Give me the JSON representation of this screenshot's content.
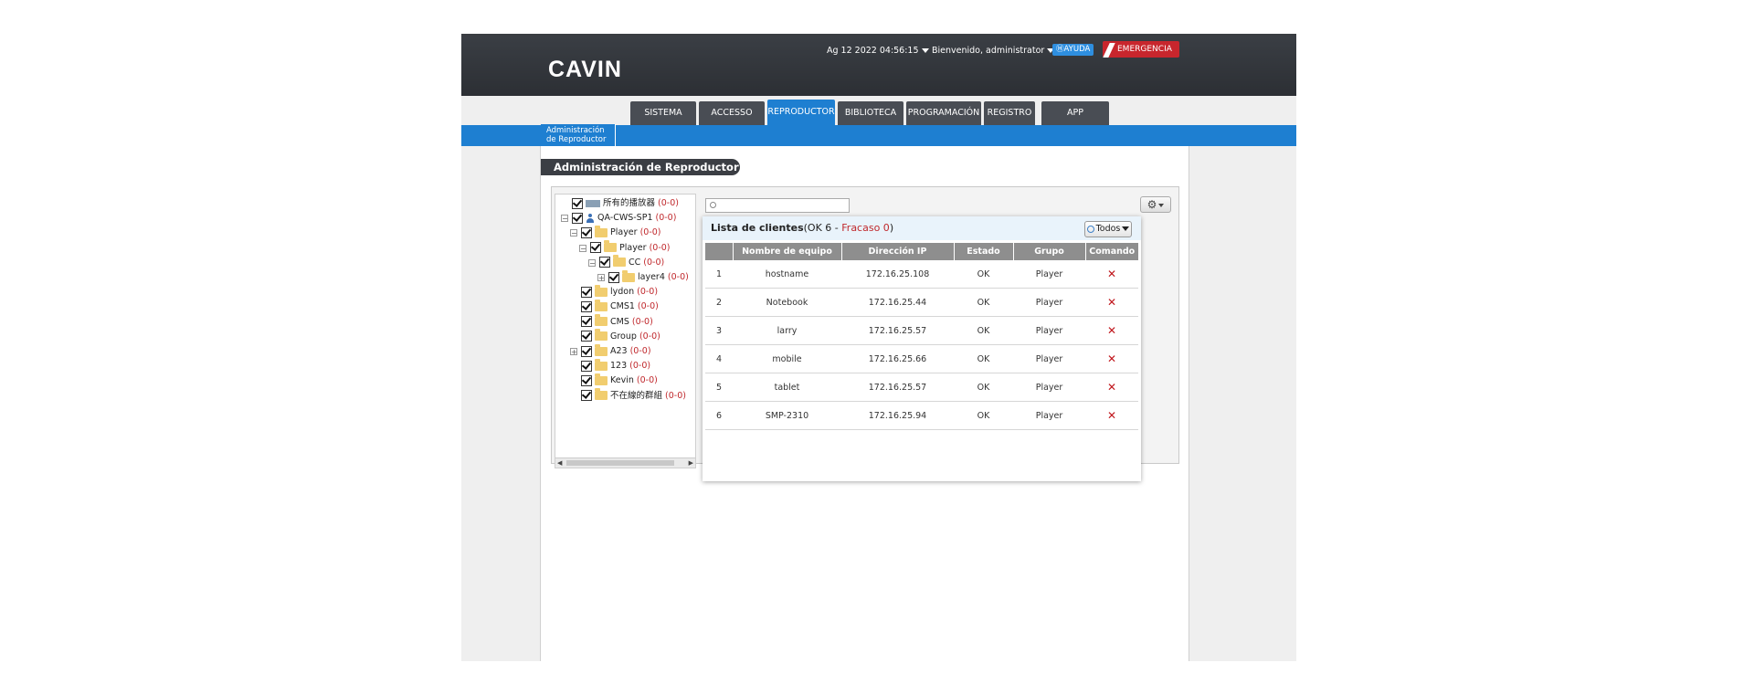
{
  "header": {
    "logo": "CAVIN",
    "datetime": "Ag 12 2022 04:56:15",
    "welcome": "Bienvenido, administrator",
    "help": "AYUDA",
    "emergency": "EMERGENCIA"
  },
  "tabs": [
    {
      "label": "SISTEMA",
      "active": false
    },
    {
      "label": "ACCESSO",
      "active": false
    },
    {
      "label": "REPRODUCTOR",
      "active": true
    },
    {
      "label": "BIBLIOTECA",
      "active": false
    },
    {
      "label": "PROGRAMACIÓN",
      "active": false
    },
    {
      "label": "REGISTRO",
      "active": false
    },
    {
      "label": "APP",
      "active": false
    }
  ],
  "subtab": {
    "line1": "Administración",
    "line2": "de Reproductor"
  },
  "section_title": "Administración de Reproductor",
  "tree": [
    {
      "label": "所有的播放器",
      "count": "(0-0)",
      "icon": "root",
      "level": 0,
      "expander": ""
    },
    {
      "label": "QA-CWS-SP1",
      "count": "(0-0)",
      "icon": "person",
      "level": 0,
      "expander": "−"
    },
    {
      "label": "Player",
      "count": "(0-0)",
      "icon": "folder",
      "level": 1,
      "expander": "−"
    },
    {
      "label": "Player",
      "count": "(0-0)",
      "icon": "folder",
      "level": 2,
      "expander": "−"
    },
    {
      "label": "CC",
      "count": "(0-0)",
      "icon": "folder",
      "level": 3,
      "expander": "−"
    },
    {
      "label": "layer4",
      "count": "(0-0)",
      "icon": "folder",
      "level": 4,
      "expander": "+"
    },
    {
      "label": "lydon",
      "count": "(0-0)",
      "icon": "folder",
      "level": 1,
      "expander": ""
    },
    {
      "label": "CMS1",
      "count": "(0-0)",
      "icon": "folder",
      "level": 1,
      "expander": ""
    },
    {
      "label": "CMS",
      "count": "(0-0)",
      "icon": "folder",
      "level": 1,
      "expander": ""
    },
    {
      "label": "Group",
      "count": "(0-0)",
      "icon": "folder",
      "level": 1,
      "expander": ""
    },
    {
      "label": "A23",
      "count": "(0-0)",
      "icon": "folder",
      "level": 1,
      "expander": "+"
    },
    {
      "label": "123",
      "count": "(0-0)",
      "icon": "folder",
      "level": 1,
      "expander": ""
    },
    {
      "label": "Kevin",
      "count": "(0-0)",
      "icon": "folder",
      "level": 1,
      "expander": ""
    },
    {
      "label": "不在線的群組",
      "count": "(0-0)",
      "icon": "folder",
      "level": 1,
      "expander": ""
    }
  ],
  "client_list": {
    "title": "Lista de clientes",
    "ok_label": "OK 6",
    "sep": " - ",
    "fail_label": "Fracaso 0",
    "filter": "Todos",
    "columns": [
      "",
      "Nombre de equipo",
      "Dirección IP",
      "Estado",
      "Grupo",
      "Comando"
    ],
    "rows": [
      {
        "idx": "1",
        "name": "hostname",
        "ip": "172.16.25.108",
        "status": "OK",
        "group": "Player",
        "cmd": "✕"
      },
      {
        "idx": "2",
        "name": "Notebook",
        "ip": "172.16.25.44",
        "status": "OK",
        "group": "Player",
        "cmd": "✕"
      },
      {
        "idx": "3",
        "name": "larry",
        "ip": "172.16.25.57",
        "status": "OK",
        "group": "Player",
        "cmd": "✕"
      },
      {
        "idx": "4",
        "name": "mobile",
        "ip": "172.16.25.66",
        "status": "OK",
        "group": "Player",
        "cmd": "✕"
      },
      {
        "idx": "5",
        "name": "tablet",
        "ip": "172.16.25.57",
        "status": "OK",
        "group": "Player",
        "cmd": "✕"
      },
      {
        "idx": "6",
        "name": "SMP-2310",
        "ip": "172.16.25.94",
        "status": "OK",
        "group": "Player",
        "cmd": "✕"
      }
    ]
  },
  "colors": {
    "accent": "#1e7fd1",
    "header": "#2c2f34",
    "emergency": "#c8262d",
    "fail": "#c0282c"
  }
}
